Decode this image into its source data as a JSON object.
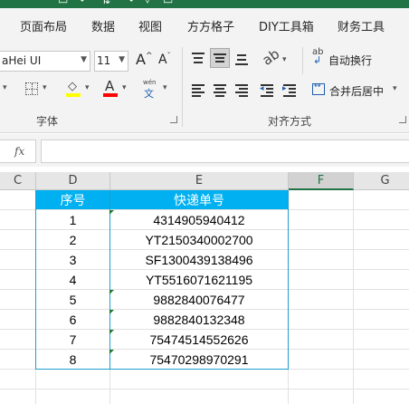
{
  "ribbon": {
    "tabs": [
      "页面布局",
      "数据",
      "视图",
      "方方格子",
      "DIY工具箱",
      "财务工具"
    ],
    "font_name": "aHei UI",
    "font_size": "11",
    "wrap_text_label": "自动换行",
    "merge_center_label": "合并后居中",
    "font_group_label": "字体",
    "align_group_label": "对齐方式",
    "pinyin_top": "wén",
    "pinyin_bottom": "文",
    "grow_label": "A",
    "shrink_label": "A",
    "font_color_label": "A",
    "wrap_icon_text": "ab",
    "fx_label": "fx"
  },
  "colors": {
    "header_fill": "#00b0f0",
    "header_text": "#ffffff",
    "accent": "#217346",
    "highlight_bar": "#ffff00",
    "font_color_bar": "#ff0000",
    "error_triangle": "#1e7b34"
  },
  "columns": [
    "C",
    "D",
    "E",
    "F",
    "G"
  ],
  "table": {
    "headers": [
      "序号",
      "快递单号"
    ],
    "rows": [
      [
        "1",
        "4314905940412"
      ],
      [
        "2",
        "YT2150340002700"
      ],
      [
        "3",
        "SF1300439138496"
      ],
      [
        "4",
        "YT5516071621195"
      ],
      [
        "5",
        "9882840076477"
      ],
      [
        "6",
        "9882840132348"
      ],
      [
        "7",
        "75474514552626"
      ],
      [
        "8",
        "75470298970291"
      ]
    ],
    "text_number_flags": [
      true,
      false,
      false,
      false,
      true,
      true,
      true,
      true
    ]
  }
}
